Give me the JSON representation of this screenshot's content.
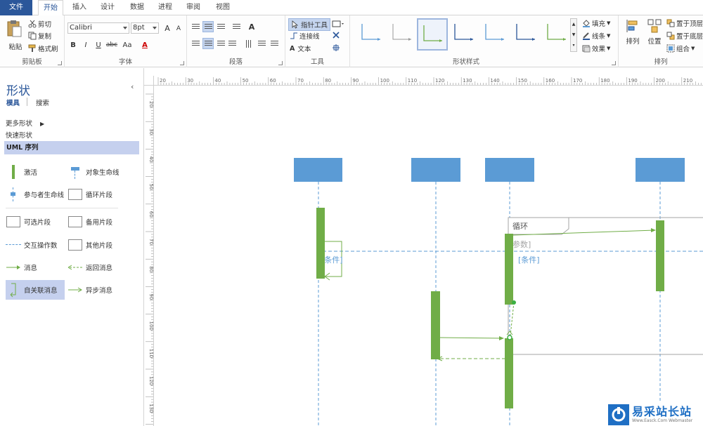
{
  "tabs": [
    {
      "label": "文件",
      "active": false,
      "file": true
    },
    {
      "label": "开始",
      "active": true
    },
    {
      "label": "插入"
    },
    {
      "label": "设计"
    },
    {
      "label": "数据"
    },
    {
      "label": "进程"
    },
    {
      "label": "审阅"
    },
    {
      "label": "视图"
    }
  ],
  "ribbon": {
    "clipboard": {
      "label": "剪贴板",
      "paste": "粘贴",
      "cut": "剪切",
      "copy": "复制",
      "format_painter": "格式刷"
    },
    "font": {
      "label": "字体",
      "family": "Calibri",
      "size": "8pt",
      "bold": "B",
      "italic": "I",
      "underline": "U",
      "strike": "abc",
      "case": "Aa",
      "color_letter": "A",
      "grow": "A",
      "shrink": "A"
    },
    "paragraph": {
      "label": "段落"
    },
    "tools": {
      "label": "工具",
      "pointer": "指针工具",
      "connector": "连接线",
      "text": "文本"
    },
    "shape_styles": {
      "label": "形状样式",
      "fill": "填充",
      "line": "线条",
      "effects": "效果"
    },
    "arrange": {
      "label": "排列",
      "align": "排列",
      "position": "位置",
      "bring_front": "置于顶层",
      "send_back": "置于底层",
      "group": "组合"
    }
  },
  "colors": {
    "accent": "#2b579a",
    "lifeline_head": "#5b9bd5",
    "activation": "#70ad47",
    "selected": "#c5d0ee"
  },
  "pane": {
    "title": "形状",
    "tab_stencils": "模具",
    "tab_search": "搜索",
    "more_shapes": "更多形状",
    "quick_shapes": "快速形状",
    "current_stencil": "UML 序列",
    "shapes": [
      {
        "label": "激活",
        "icon": "activation-icon"
      },
      {
        "label": "对象生命线",
        "icon": "object-lifeline-icon"
      },
      {
        "label": "参与者生命线",
        "icon": "actor-lifeline-icon"
      },
      {
        "label": "循环片段",
        "icon": "fragment-icon"
      },
      {
        "label": "可选片段",
        "icon": "fragment-icon"
      },
      {
        "label": "备用片段",
        "icon": "fragment-icon"
      },
      {
        "label": "交互操作数",
        "icon": "dashed-line-icon"
      },
      {
        "label": "其他片段",
        "icon": "fragment-icon"
      },
      {
        "label": "消息",
        "icon": "message-arrow-icon"
      },
      {
        "label": "返回消息",
        "icon": "return-arrow-icon"
      },
      {
        "label": "自关联消息",
        "icon": "self-message-icon",
        "selected": true
      },
      {
        "label": "异步消息",
        "icon": "async-arrow-icon"
      }
    ]
  },
  "ruler": {
    "h_labels": [
      "20",
      "30",
      "40",
      "50",
      "60",
      "70",
      "80",
      "90",
      "100",
      "110",
      "120",
      "130",
      "140",
      "150",
      "160",
      "170",
      "180",
      "190",
      "200",
      "210"
    ],
    "v_labels": [
      "20",
      "30",
      "40",
      "50",
      "60",
      "70",
      "80",
      "90",
      "100",
      "110",
      "120",
      "130",
      "140"
    ]
  },
  "diagram": {
    "loop_label": "循环",
    "param_label": "参数]",
    "condition_left": "[条件]",
    "condition_right": "[条件]"
  },
  "watermark": {
    "text": "易采站长站",
    "sub": "Www.Easck.Com Webmaster"
  }
}
